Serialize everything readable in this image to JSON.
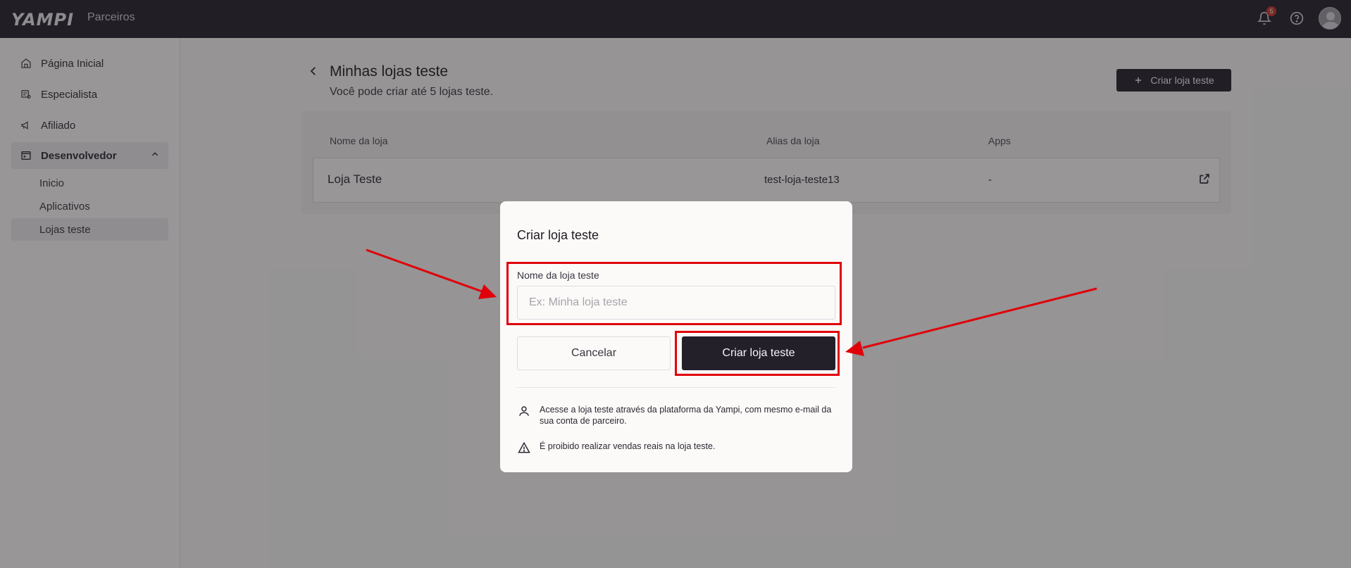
{
  "topbar": {
    "logo": "YAMPI",
    "product": "Parceiros",
    "notifications_count": "5"
  },
  "sidebar": {
    "items": [
      {
        "label": "Página Inicial",
        "icon": "home-icon"
      },
      {
        "label": "Especialista",
        "icon": "specialist-icon"
      },
      {
        "label": "Afiliado",
        "icon": "megaphone-icon"
      },
      {
        "label": "Desenvolvedor",
        "icon": "terminal-icon"
      }
    ],
    "sub_items": [
      {
        "label": "Inicio"
      },
      {
        "label": "Aplicativos"
      },
      {
        "label": "Lojas teste"
      }
    ]
  },
  "main": {
    "title": "Minhas lojas teste",
    "subtitle": "Você pode criar até 5 lojas teste.",
    "create_button": "Criar loja teste",
    "table": {
      "headers": [
        "Nome da loja",
        "Alias da loja",
        "Apps"
      ],
      "rows": [
        {
          "name": "Loja Teste",
          "alias": "test-loja-teste13",
          "apps": "-"
        }
      ]
    }
  },
  "modal": {
    "title": "Criar loja teste",
    "field_label": "Nome da loja teste",
    "field_placeholder": "Ex: Minha loja teste",
    "field_value": "",
    "cancel_label": "Cancelar",
    "submit_label": "Criar loja teste",
    "info": [
      "Acesse a loja teste através da plataforma da Yampi, com mesmo e-mail da sua conta de parceiro.",
      "É proibido realizar vendas reais na loja teste."
    ]
  },
  "annotations": {
    "color": "#e0000a"
  }
}
